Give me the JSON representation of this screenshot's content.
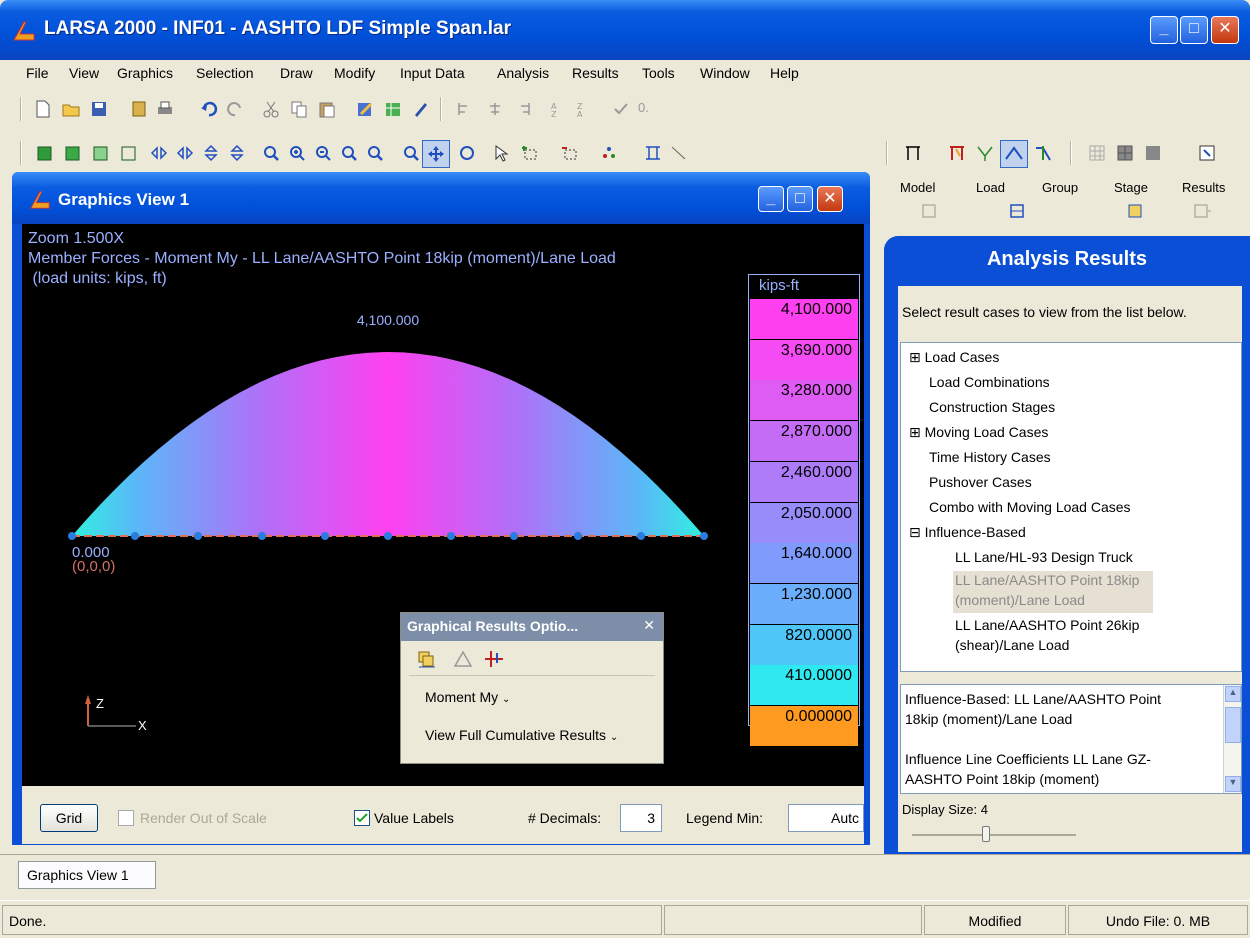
{
  "app": {
    "title": "LARSA 2000 - INF01 - AASHTO LDF Simple Span.lar",
    "window_buttons": [
      "_",
      "□",
      "✕"
    ]
  },
  "menu": [
    "File",
    "View",
    "Graphics",
    "Selection",
    "Draw",
    "Modify",
    "Input Data",
    "Analysis",
    "Results",
    "Tools",
    "Window",
    "Help"
  ],
  "toolbar1": {
    "sort_suffix": "0."
  },
  "graphics_view": {
    "title": "Graphics View 1",
    "zoom": "Zoom  1.500X",
    "caption1": "Member Forces - Moment My - LL Lane/AASHTO Point 18kip (moment)/Lane Load",
    "caption2": " (load units: kips, ft)",
    "peak_label": "4,100.000",
    "origin_value": "0.000",
    "origin_coord": "(0,0,0)",
    "axis_z": "Z",
    "axis_x": "X",
    "legend": {
      "unit": "kips-ft",
      "values": [
        "4,100.000",
        "3,690.000",
        "3,280.000",
        "2,870.000",
        "2,460.000",
        "2,050.000",
        "1,640.000",
        "1,230.000",
        "820.0000",
        "410.0000",
        "0.000000"
      ],
      "colors": [
        "#ff40f0",
        "#f44cf2",
        "#de5cf4",
        "#c56cf6",
        "#ae7cf8",
        "#988cfa",
        "#7f9cfc",
        "#6aaefc",
        "#4ec6f8",
        "#30e8f0",
        "#ff9a20"
      ]
    },
    "bottom": {
      "grid_button": "Grid",
      "render_out_of_scale": "Render Out of Scale",
      "value_labels": "Value Labels",
      "decimals_label": "# Decimals:",
      "decimals_value": "3",
      "legend_min_label": "Legend Min:",
      "legend_min_value": "Autc"
    }
  },
  "graphical_results_options": {
    "title": "Graphical Results Optio...",
    "close": "✕",
    "item1": "Moment My",
    "item2": "View Full Cumulative Results"
  },
  "right_tabs": [
    "Model",
    "Load",
    "Group",
    "Stage",
    "Results"
  ],
  "analysis_results": {
    "title": "Analysis Results",
    "description": "Select result cases to view from the list below.",
    "tree": [
      "⊞ Load Cases",
      "Load Combinations",
      "Construction Stages",
      "⊞ Moving Load Cases",
      "Time History Cases",
      "Pushover Cases",
      "Combo with Moving Load Cases",
      "⊟ Influence-Based",
      "LL Lane/HL-93 Design Truck",
      "LL Lane/AASHTO Point 18kip",
      "(moment)/Lane Load",
      "LL Lane/AASHTO Point 26kip",
      "(shear)/Lane Load"
    ],
    "info": {
      "line1": "Influence-Based: LL Lane/AASHTO Point",
      "line2": "18kip (moment)/Lane Load",
      "line3": "Influence Line Coefficients LL Lane GZ-",
      "line4": "AASHTO Point 18kip (moment)"
    },
    "display_size": "Display Size: 4"
  },
  "tabs": [
    "Graphics View 1"
  ],
  "status": {
    "left": "Done.",
    "modified": "Modified",
    "undo": "Undo File: 0. MB"
  }
}
